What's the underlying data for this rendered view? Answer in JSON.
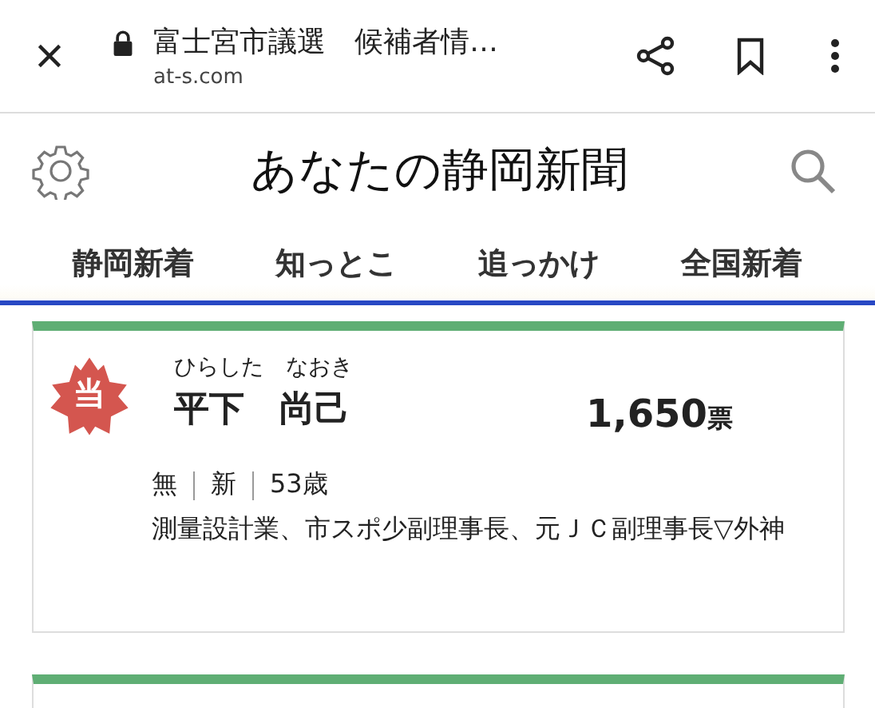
{
  "browser_bar": {
    "title": "富士宮市議選　候補者情…",
    "url": "at-s.com"
  },
  "header": {
    "title": "あなたの静岡新聞"
  },
  "tabs": [
    {
      "label": "静岡新着"
    },
    {
      "label": "知っとこ"
    },
    {
      "label": "追っかけ"
    },
    {
      "label": "全国新着"
    }
  ],
  "candidates": [
    {
      "badge": "当",
      "reading": "ひらした　なおき",
      "name": "平下　尚己",
      "votes": "1,650",
      "votes_unit": "票",
      "meta": [
        "無",
        "新",
        "53歳"
      ],
      "description": "測量設計業、市スポ少副理事長、元ＪＣ副理事長▽外神"
    }
  ]
}
